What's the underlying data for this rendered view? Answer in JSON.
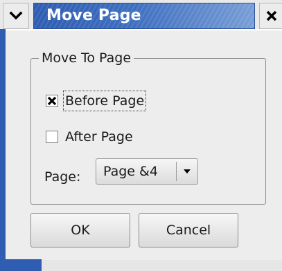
{
  "window": {
    "title": "Move Page",
    "menu_icon": "chevron-down-icon",
    "close_icon": "close-icon",
    "accent_color": "#2e5db1"
  },
  "dialog": {
    "group_label": "Move To Page",
    "options": [
      {
        "label": "Before Page",
        "checked": true,
        "focused": true
      },
      {
        "label": "After Page",
        "checked": false,
        "focused": false
      }
    ],
    "page_field": {
      "label": "Page:",
      "selected_value": "Page &4"
    },
    "buttons": {
      "ok_label": "OK",
      "cancel_label": "Cancel"
    }
  }
}
